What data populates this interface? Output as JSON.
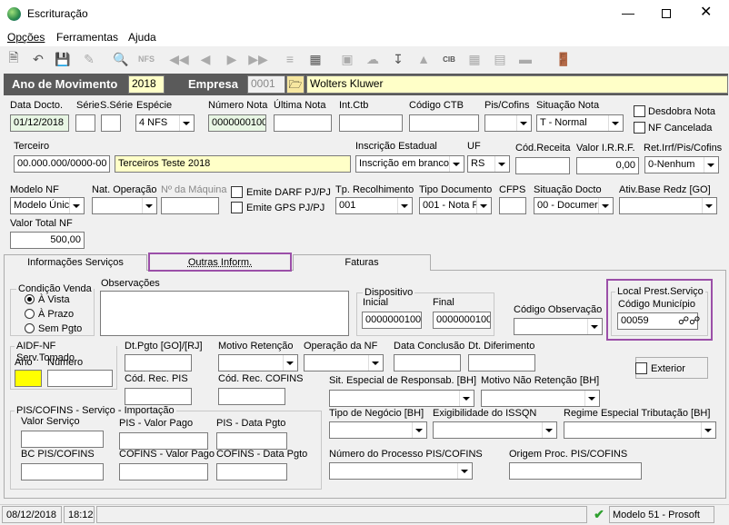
{
  "window": {
    "title": "Escrituração",
    "icon": "app-globe-icon"
  },
  "menu": [
    "Opções",
    "Ferramentas",
    "Ajuda"
  ],
  "header": {
    "ano_label": "Ano de Movimento",
    "ano_value": "2018",
    "empresa_label": "Empresa",
    "empresa_code": "0001",
    "empresa_name": "Wolters Kluwer"
  },
  "row1": {
    "data_docto_label": "Data Docto.",
    "data_docto": "01/12/2018",
    "serie_label": "Série",
    "sserie_label": "S.Série",
    "especie_label": "Espécie",
    "especie": "4 NFS",
    "numero_nota_label": "Número Nota",
    "numero_nota": "0000000100",
    "ultima_nota_label": "Última Nota",
    "int_ctb_label": "Int.Ctb",
    "codigo_ctb_label": "Código CTB",
    "pis_cofins_label": "Pis/Cofins",
    "situacao_nota_label": "Situação Nota",
    "situacao_nota": "T - Normal",
    "desdobra_label": "Desdobra Nota",
    "nf_cancelada_label": "NF Cancelada"
  },
  "row2": {
    "terceiro_label": "Terceiro",
    "terceiro_doc": "00.000.000/0000-00",
    "terceiro_name": "Terceiros Teste 2018",
    "ie_label": "Inscrição Estadual",
    "ie_value": "Inscrição em branco",
    "uf_label": "UF",
    "uf_value": "RS",
    "cod_receita_label": "Cód.Receita",
    "irrf_label": "Valor I.R.R.F.",
    "irrf_value": "0,00",
    "ret_label": "Ret.Irrf/Pis/Cofins",
    "ret_value": "0-Nenhum"
  },
  "row3": {
    "modelo_label": "Modelo NF",
    "modelo_value": "Modelo Únic",
    "nat_label": "Nat. Operação",
    "maquina_label": "Nº da Máquina",
    "darf_label": "Emite DARF PJ/PJ",
    "gps_label": "Emite GPS PJ/PJ",
    "recolhimento_label": "Tp. Recolhimento",
    "recolhimento_value": "001",
    "tipo_doc_label": "Tipo Documento",
    "tipo_doc_value": "001 - Nota F",
    "cfps_label": "CFPS",
    "sit_docto_label": "Situação Docto",
    "sit_docto_value": "00 - Documer",
    "ativ_label": "Ativ.Base Redz [GO]"
  },
  "row4": {
    "valor_total_label": "Valor Total NF",
    "valor_total": "500,00"
  },
  "tabs": [
    "Informações Serviços",
    "Outras Inform.",
    "Faturas"
  ],
  "outras": {
    "condicao_title": "Condição Venda",
    "cond_options": [
      "À Vista",
      "À Prazo",
      "Sem Pgto"
    ],
    "obs_label": "Observações",
    "dispositivo_title": "Dispositivo",
    "inicial_label": "Inicial",
    "inicial": "0000000100",
    "final_label": "Final",
    "final": "0000000100",
    "cod_obs_label": "Código Observação",
    "local_title": "Local Prest.Serviço",
    "cod_mun_label": "Código Município",
    "cod_mun": "00059",
    "aidf_title": "AIDF-NF Serv.Tomado",
    "ano_label": "Ano",
    "numero_label": "Número",
    "dt_pgto_label": "Dt.Pgto [GO]/[RJ]",
    "motivo_ret_label": "Motivo Retenção",
    "op_nf_label": "Operação da NF",
    "data_conc_label": "Data Conclusão",
    "dt_dif_label": "Dt. Diferimento",
    "exterior_label": "Exterior",
    "cod_pis_label": "Cód. Rec. PIS",
    "cod_cofins_label": "Cód. Rec. COFINS",
    "sit_esp_label": "Sit. Especial de Responsab. [BH]",
    "motivo_nao_label": "Motivo Não Retenção [BH]",
    "pis_imp_title": "PIS/COFINS - Serviço - Importação",
    "valor_serv_label": "Valor Serviço",
    "pis_valor_label": "PIS - Valor Pago",
    "pis_data_label": "PIS - Data Pgto",
    "bc_label": "BC PIS/COFINS",
    "cofins_valor_label": "COFINS - Valor Pago",
    "cofins_data_label": "COFINS - Data Pgto",
    "tipo_neg_label": "Tipo de Negócio [BH]",
    "exig_label": "Exigibilidade do ISSQN",
    "regime_label": "Regime Especial Tributação [BH]",
    "num_proc_label": "Número do Processo PIS/COFINS",
    "origem_label": "Origem Proc. PIS/COFINS"
  },
  "status": {
    "date": "08/12/2018",
    "time": "18:12",
    "model": "Modelo 51 - Prosoft"
  },
  "accent": {
    "header_bg": "#5a5a5a",
    "highlight": "#9b4fa8",
    "yellow": "#ffff00"
  }
}
